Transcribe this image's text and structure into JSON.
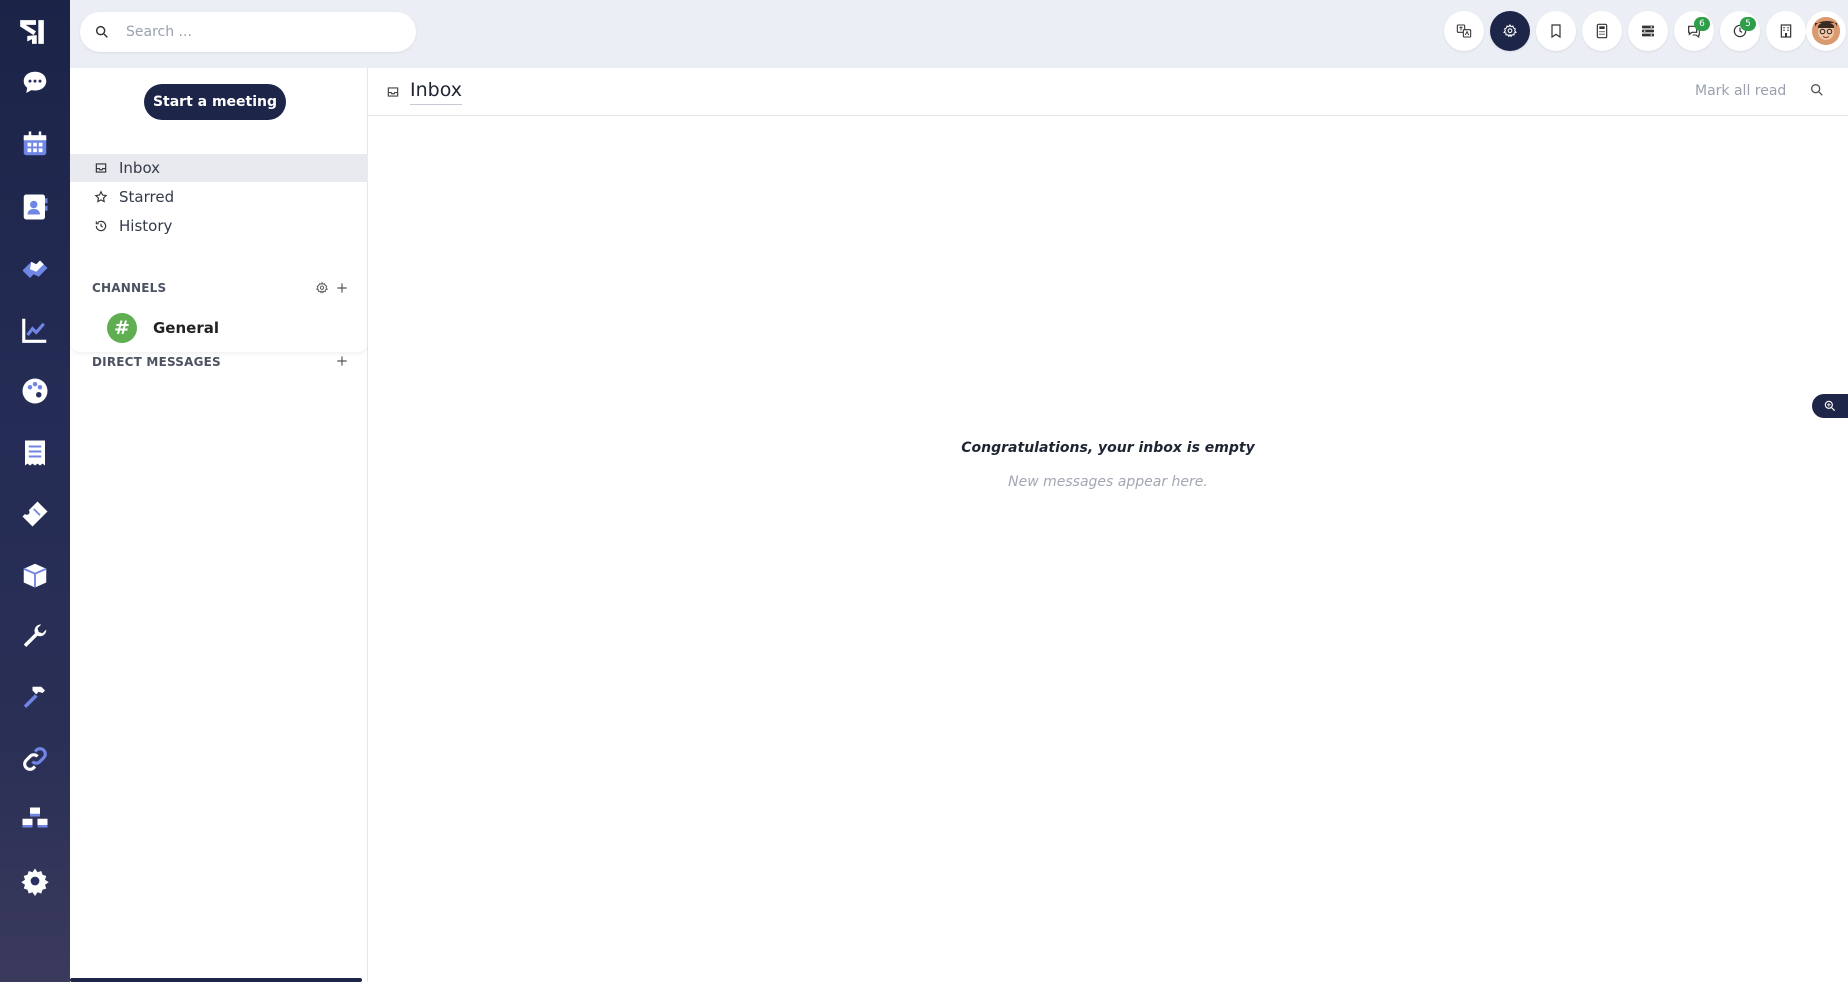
{
  "search": {
    "placeholder": "Search ..."
  },
  "topbar": {
    "badges": {
      "discussions": "6",
      "activities": "5"
    }
  },
  "sidebar": {
    "meeting_button": "Start a meeting",
    "nav": [
      {
        "label": "Inbox",
        "icon": "inbox-icon"
      },
      {
        "label": "Starred",
        "icon": "star-icon"
      },
      {
        "label": "History",
        "icon": "history-icon"
      }
    ],
    "channels_title": "CHANNELS",
    "channels": [
      {
        "name": "General",
        "icon": "hash-icon"
      }
    ],
    "direct_messages_title": "DIRECT MESSAGES"
  },
  "main": {
    "title": "Inbox",
    "mark_all_read": "Mark all read",
    "empty_title": "Congratulations, your inbox is empty",
    "empty_subtitle": "New messages appear here."
  },
  "colors": {
    "accent": "#1d2548",
    "badge": "#2e9e4a",
    "channel": "#5fae52",
    "rail_icon": "#6f86e6"
  }
}
